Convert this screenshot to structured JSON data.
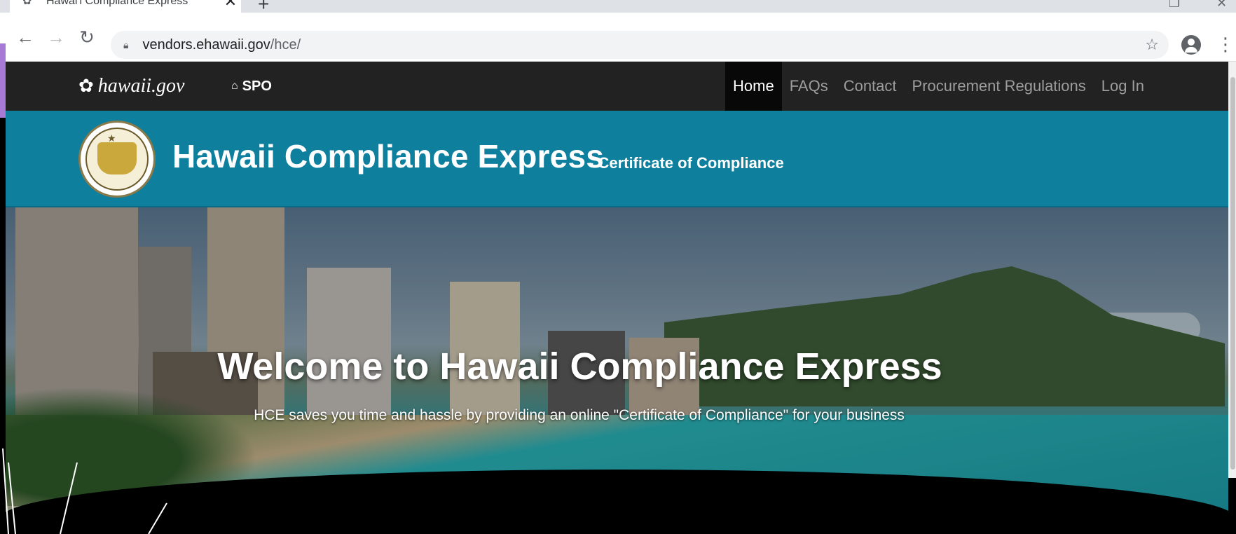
{
  "browser": {
    "tab_title": "Hawai'i Compliance Express",
    "tab_close": "✕",
    "new_tab": "+",
    "url_host": "vendors.ehawaii.gov",
    "url_path": "/hce/"
  },
  "nav": {
    "brand": "hawaii.gov",
    "spo": "SPO",
    "links": [
      "Home",
      "FAQs",
      "Contact",
      "Procurement Regulations",
      "Log In"
    ],
    "active": "Home"
  },
  "banner": {
    "title": "Hawaii Compliance Express",
    "subtitle": "- Certificate of Compliance"
  },
  "hero": {
    "title": "Welcome to Hawaii Compliance Express",
    "subtitle": "HCE saves you time and hassle by providing an online \"Certificate of Compliance\" for your business"
  },
  "icons": {
    "back": "back-arrow-icon",
    "forward": "forward-arrow-icon",
    "reload": "reload-icon",
    "lock": "lock-icon",
    "star": "star-icon",
    "account": "account-icon",
    "menu": "menu-dots-icon",
    "home": "home-icon",
    "hibiscus": "hibiscus-icon"
  },
  "colors": {
    "nav_bg": "#222222",
    "banner_bg": "#0f7f9e"
  }
}
